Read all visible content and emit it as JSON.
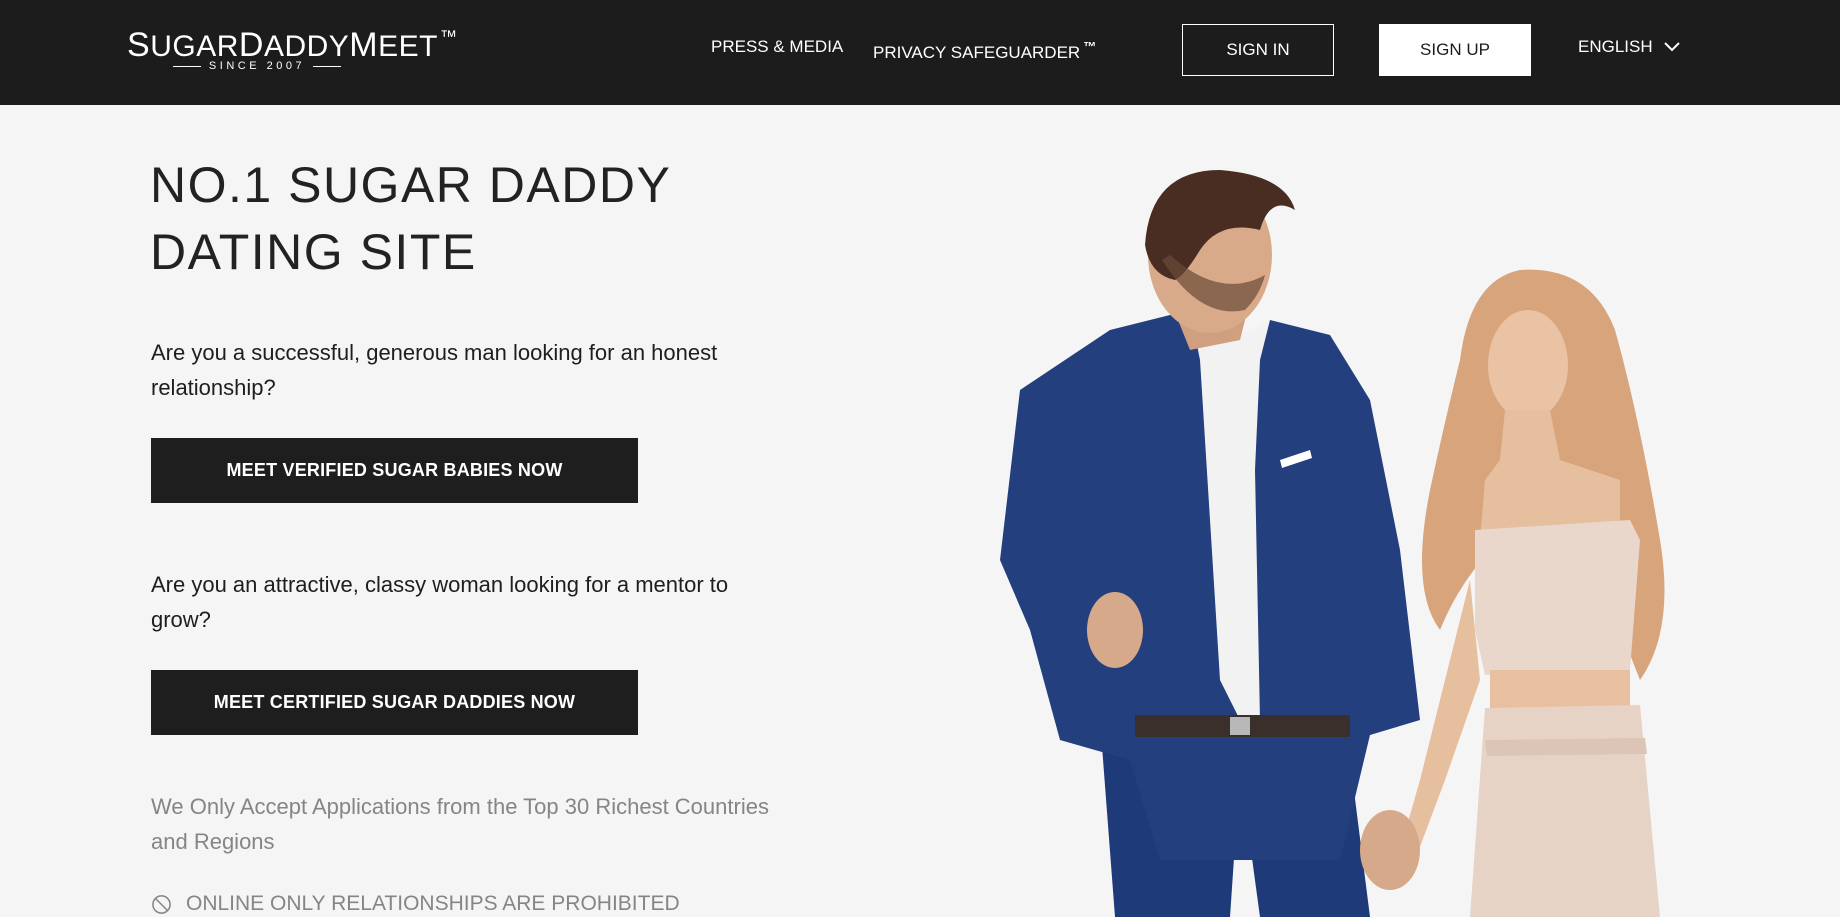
{
  "header": {
    "logo": {
      "name_parts": [
        "S",
        "UGAR",
        "D",
        "ADDY",
        "M",
        "EET"
      ],
      "trademark": "™",
      "tagline": "SINCE 2007"
    },
    "nav": {
      "press": "PRESS & MEDIA",
      "privacy": "PRIVACY SAFEGUARDER",
      "privacy_tm": "™"
    },
    "sign_in": "SIGN IN",
    "sign_up": "SIGN UP",
    "language": "ENGLISH"
  },
  "hero": {
    "title_line1": "NO.1 SUGAR DADDY",
    "title_line2": "DATING SITE",
    "question_men": "Are you a successful, generous man looking for an honest relationship?",
    "cta_men": "MEET VERIFIED SUGAR BABIES NOW",
    "question_women": "Are you an attractive, classy woman looking for a mentor to grow?",
    "cta_women": "MEET CERTIFIED SUGAR DADDIES NOW",
    "note": "We Only Accept Applications from the Top 30 Richest Countries and Regions",
    "prohibited": "ONLINE ONLY RELATIONSHIPS ARE PROHIBITED"
  },
  "colors": {
    "header_bg": "#1c1c1c",
    "page_bg": "#f5f5f5",
    "button_dark": "#1e1e1e",
    "muted_text": "#858585",
    "suit_blue": "#1f3a78"
  },
  "icons": {
    "language_chevron": "chevron-down-icon",
    "prohibited": "prohibited-icon"
  }
}
